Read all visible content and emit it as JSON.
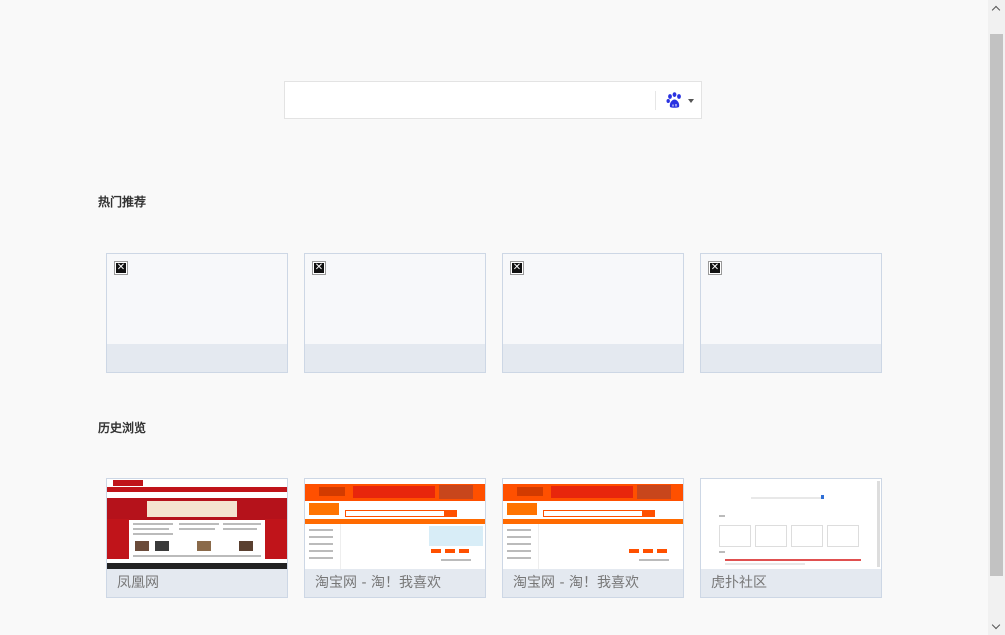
{
  "search": {
    "value": "",
    "placeholder": "",
    "engine_icon": "baidu-paw-icon",
    "caret_icon": "caret-down-icon"
  },
  "hot": {
    "title": "热门推荐",
    "tiles": [
      {
        "caption": "",
        "icon": "broken-image-icon"
      },
      {
        "caption": "",
        "icon": "broken-image-icon"
      },
      {
        "caption": "",
        "icon": "broken-image-icon"
      },
      {
        "caption": "",
        "icon": "broken-image-icon"
      }
    ]
  },
  "history": {
    "title": "历史浏览",
    "tiles": [
      {
        "caption": "凤凰网"
      },
      {
        "caption": "淘宝网 - 淘！我喜欢"
      },
      {
        "caption": "淘宝网 - 淘！我喜欢"
      },
      {
        "caption": "虎扑社区"
      }
    ]
  },
  "colors": {
    "page_bg": "#f9f9f9",
    "tile_border": "#cdd7e5",
    "caption_bg": "#e4e9f0",
    "baidu_blue": "#2932e1",
    "ifeng_red": "#c0141a",
    "taobao_orange": "#ff5000"
  }
}
